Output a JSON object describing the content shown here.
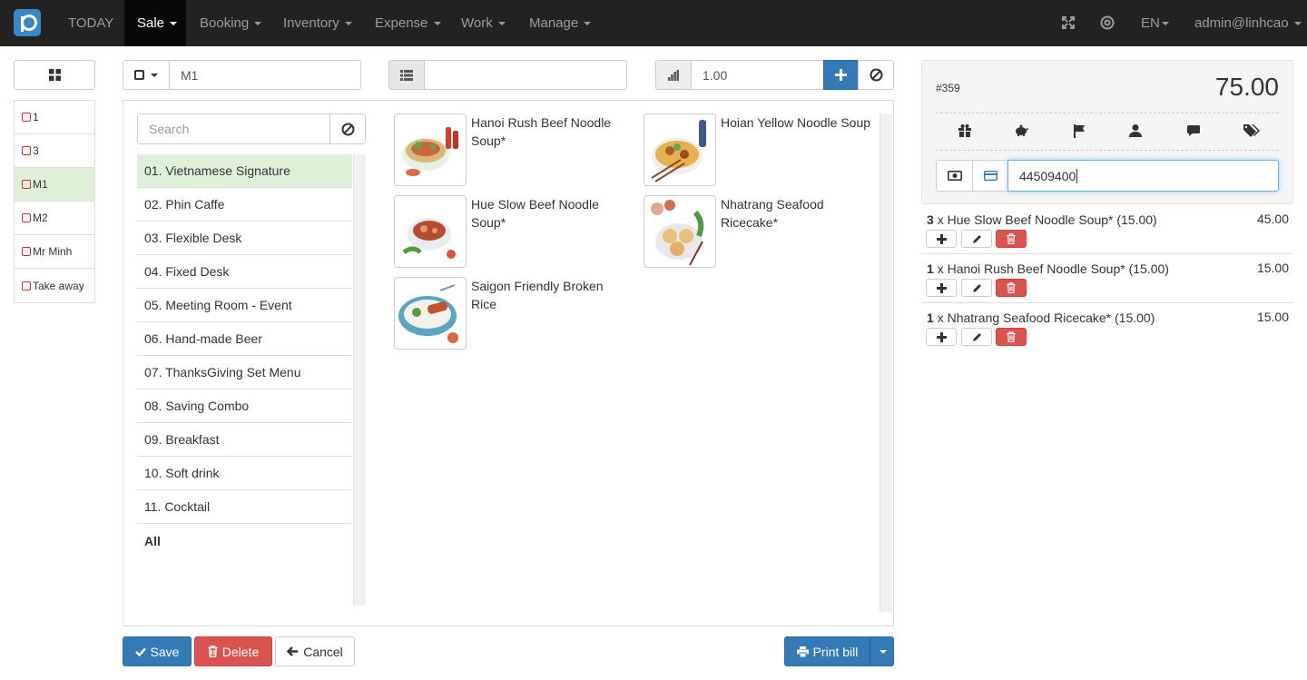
{
  "nav": {
    "items": [
      {
        "label": "TODAY",
        "dropdown": false
      },
      {
        "label": "Sale",
        "dropdown": true
      },
      {
        "label": "Booking",
        "dropdown": true
      },
      {
        "label": "Inventory",
        "dropdown": true
      },
      {
        "label": "Expense",
        "dropdown": true
      },
      {
        "label": "Work",
        "dropdown": true
      },
      {
        "label": "Manage",
        "dropdown": true
      }
    ],
    "language": "EN",
    "user": "admin@linhcao"
  },
  "tables": [
    "1",
    "3",
    "M1",
    "M2",
    "Mr Minh",
    "Take away"
  ],
  "selected_table": "M1",
  "table_field": "M1",
  "note_field": "",
  "quantity_field": "1.00",
  "search_placeholder": "Search",
  "categories": [
    "01. Vietnamese Signature",
    "02. Phin Caffe",
    "03. Flexible Desk",
    "04. Fixed Desk",
    "05. Meeting Room - Event",
    "06. Hand-made Beer",
    "07. ThanksGiving Set Menu",
    "08. Saving Combo",
    "09. Breakfast",
    "10. Soft drink",
    "11. Cocktail",
    "All"
  ],
  "products": [
    "Hanoi Rush Beef Noodle Soup*",
    "Hoian Yellow Noodle Soup",
    "Hue Slow Beef Noodle Soup*",
    "Nhatrang Seafood Ricecake*",
    "Saigon Friendly Broken Rice"
  ],
  "buttons": {
    "save": "Save",
    "delete": "Delete",
    "cancel": "Cancel",
    "print": "Print bill"
  },
  "order": {
    "number": "#359",
    "total": "75.00",
    "card_input": "44509400",
    "lines": [
      {
        "qty": "3",
        "text": "x Hue Slow Beef Noodle Soup* (15.00)",
        "amount": "45.00"
      },
      {
        "qty": "1",
        "text": "x Hanoi Rush Beef Noodle Soup* (15.00)",
        "amount": "15.00"
      },
      {
        "qty": "1",
        "text": "x Nhatrang Seafood Ricecake* (15.00)",
        "amount": "15.00"
      }
    ]
  },
  "colors": {
    "primary": "#337ab7",
    "danger": "#d9534f",
    "selected_row": "#dff0d8",
    "navbar": "#222222"
  }
}
